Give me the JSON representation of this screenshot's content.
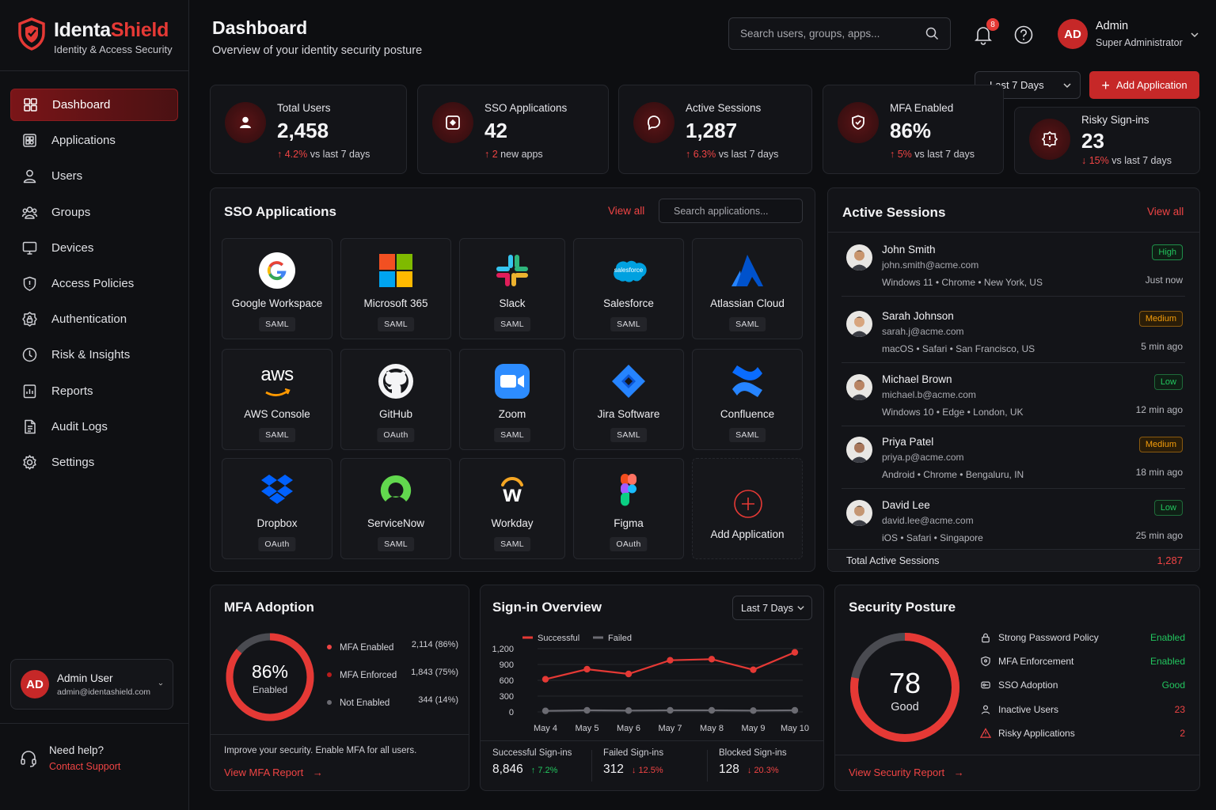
{
  "brand": {
    "name_a": "Identa",
    "name_b": "Shield",
    "tagline": "Identity & Access Security"
  },
  "nav": [
    {
      "label": "Dashboard",
      "icon": "grid-icon",
      "active": true
    },
    {
      "label": "Applications",
      "icon": "apps-icon"
    },
    {
      "label": "Users",
      "icon": "user-icon"
    },
    {
      "label": "Groups",
      "icon": "group-icon"
    },
    {
      "label": "Devices",
      "icon": "monitor-icon"
    },
    {
      "label": "Access Policies",
      "icon": "shield-icon"
    },
    {
      "label": "Authentication",
      "icon": "lock-badge-icon"
    },
    {
      "label": "Risk & Insights",
      "icon": "risk-icon"
    },
    {
      "label": "Reports",
      "icon": "report-icon"
    },
    {
      "label": "Audit Logs",
      "icon": "document-icon"
    },
    {
      "label": "Settings",
      "icon": "gear-icon"
    }
  ],
  "user_card": {
    "initials": "AD",
    "name": "Admin User",
    "email": "admin@identashield.com"
  },
  "help": {
    "title": "Need help?",
    "link": "Contact Support"
  },
  "header": {
    "title": "Dashboard",
    "subtitle": "Overview of your identity security posture",
    "search_placeholder": "Search users, groups, apps...",
    "notif_count": "8",
    "user_initials": "AD",
    "user_name": "Admin",
    "user_role": "Super Administrator"
  },
  "controls": {
    "range": "Last 7 Days",
    "add_app": "Add Application"
  },
  "stats": [
    {
      "label": "Total Users",
      "value": "2,458",
      "delta": "4.2%",
      "delta_text": " vs last 7 days",
      "dir": "up",
      "icon": "user-icon"
    },
    {
      "label": "SSO Applications",
      "value": "42",
      "delta": "2",
      "delta_text": " new apps",
      "dir": "up",
      "icon": "app-window-icon"
    },
    {
      "label": "Active Sessions",
      "value": "1,287",
      "delta": "6.3%",
      "delta_text": " vs last 7 days",
      "dir": "up",
      "icon": "chat-icon"
    },
    {
      "label": "MFA Enabled",
      "value": "86%",
      "delta": "5%",
      "delta_text": " vs last 7 days",
      "dir": "up",
      "icon": "shield-check-icon"
    },
    {
      "label": "Risky Sign-ins",
      "value": "23",
      "delta": "15%",
      "delta_text": " vs last 7 days",
      "dir": "down",
      "icon": "alert-icon"
    }
  ],
  "sso": {
    "title": "SSO Applications",
    "view_all": "View all",
    "search_placeholder": "Search applications...",
    "apps": [
      {
        "name": "Google Workspace",
        "protocol": "SAML",
        "logo": "google-logo-icon"
      },
      {
        "name": "Microsoft 365",
        "protocol": "SAML",
        "logo": "microsoft-logo-icon"
      },
      {
        "name": "Slack",
        "protocol": "SAML",
        "logo": "slack-logo-icon"
      },
      {
        "name": "Salesforce",
        "protocol": "SAML",
        "logo": "salesforce-logo-icon",
        "logo_text": "salesforce"
      },
      {
        "name": "Atlassian Cloud",
        "protocol": "SAML",
        "logo": "atlassian-logo-icon"
      },
      {
        "name": "AWS Console",
        "protocol": "SAML",
        "logo": "aws-logo-icon",
        "logo_text": "aws"
      },
      {
        "name": "GitHub",
        "protocol": "OAuth",
        "logo": "github-logo-icon"
      },
      {
        "name": "Zoom",
        "protocol": "SAML",
        "logo": "zoom-logo-icon"
      },
      {
        "name": "Jira Software",
        "protocol": "SAML",
        "logo": "jira-logo-icon"
      },
      {
        "name": "Confluence",
        "protocol": "SAML",
        "logo": "confluence-logo-icon"
      },
      {
        "name": "Dropbox",
        "protocol": "OAuth",
        "logo": "dropbox-logo-icon"
      },
      {
        "name": "ServiceNow",
        "protocol": "SAML",
        "logo": "servicenow-logo-icon"
      },
      {
        "name": "Workday",
        "protocol": "SAML",
        "logo": "workday-logo-icon",
        "logo_text": "w"
      },
      {
        "name": "Figma",
        "protocol": "OAuth",
        "logo": "figma-logo-icon"
      }
    ],
    "add_label": "Add Application"
  },
  "sessions": {
    "title": "Active Sessions",
    "view_all": "View all",
    "total_label": "Total Active Sessions",
    "total": "1,287",
    "items": [
      {
        "name": "John Smith",
        "email": "john.smith@acme.com",
        "os": "Windows 11",
        "browser": "Chrome",
        "loc": "New York, US",
        "level": "High",
        "time": "Just now"
      },
      {
        "name": "Sarah Johnson",
        "email": "sarah.j@acme.com",
        "os": "macOS",
        "browser": "Safari",
        "loc": "San Francisco, US",
        "level": "Medium",
        "time": "5 min ago"
      },
      {
        "name": "Michael Brown",
        "email": "michael.b@acme.com",
        "os": "Windows 10",
        "browser": "Edge",
        "loc": "London, UK",
        "level": "Low",
        "time": "12 min ago"
      },
      {
        "name": "Priya Patel",
        "email": "priya.p@acme.com",
        "os": "Android",
        "browser": "Chrome",
        "loc": "Bengaluru, IN",
        "level": "Medium",
        "time": "18 min ago"
      },
      {
        "name": "David Lee",
        "email": "david.lee@acme.com",
        "os": "iOS",
        "browser": "Safari",
        "loc": "Singapore",
        "level": "Low",
        "time": "25 min ago"
      }
    ]
  },
  "mfa": {
    "title": "MFA Adoption",
    "pct": "86%",
    "pct_value": 0.86,
    "center_label": "Enabled",
    "legend": [
      {
        "label": "MFA Enabled",
        "value": "2,114 (86%)",
        "color": "#ef4444"
      },
      {
        "label": "MFA Enforced",
        "value": "1,843 (75%)",
        "color": "#b91c1c"
      },
      {
        "label": "Not Enabled",
        "value": "344 (14%)",
        "color": "#6b6b72"
      }
    ],
    "note": "Improve your security. Enable MFA for all users.",
    "link": "View MFA Report"
  },
  "signin": {
    "title": "Sign-in Overview",
    "range": "Last 7 Days",
    "summary": [
      {
        "label": "Successful Sign-ins",
        "value": "8,846",
        "delta": "7.2%",
        "dir": "up"
      },
      {
        "label": "Failed Sign-ins",
        "value": "312",
        "delta": "12.5%",
        "dir": "down"
      },
      {
        "label": "Blocked Sign-ins",
        "value": "128",
        "delta": "20.3%",
        "dir": "down"
      }
    ]
  },
  "chart_data": {
    "type": "line",
    "categories": [
      "May 4",
      "May 5",
      "May 6",
      "May 7",
      "May 8",
      "May 9",
      "May 10"
    ],
    "series": [
      {
        "name": "Successful",
        "values": [
          620,
          810,
          720,
          980,
          1000,
          800,
          1130
        ],
        "color": "#e53935"
      },
      {
        "name": "Failed",
        "values": [
          20,
          30,
          25,
          30,
          30,
          25,
          30
        ],
        "color": "#6b6b72"
      }
    ],
    "yticks": [
      "0",
      "300",
      "600",
      "900",
      "1,200"
    ],
    "ylim": [
      0,
      1200
    ]
  },
  "posture": {
    "title": "Security Posture",
    "score": "78",
    "score_value": 0.78,
    "grade": "Good",
    "link": "View Security Report",
    "items": [
      {
        "label": "Strong Password Policy",
        "value": "Enabled",
        "status": "good",
        "icon": "lock-icon"
      },
      {
        "label": "MFA Enforcement",
        "value": "Enabled",
        "status": "good",
        "icon": "shield-icon"
      },
      {
        "label": "SSO Adoption",
        "value": "Good",
        "status": "good",
        "icon": "key-icon"
      },
      {
        "label": "Inactive Users",
        "value": "23",
        "status": "bad",
        "icon": "user-icon"
      },
      {
        "label": "Risky Applications",
        "value": "2",
        "status": "bad",
        "icon": "warning-icon"
      }
    ]
  }
}
